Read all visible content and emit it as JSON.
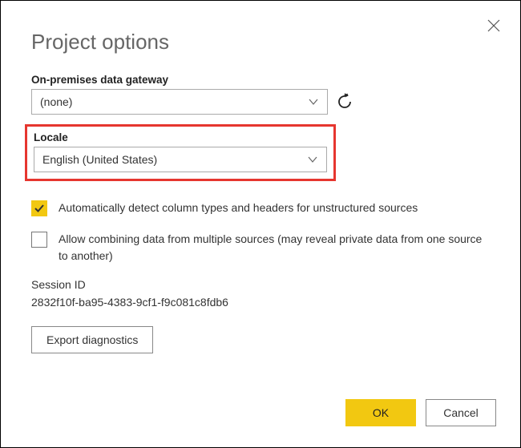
{
  "title": "Project options",
  "gateway": {
    "label": "On-premises data gateway",
    "value": "(none)"
  },
  "locale": {
    "label": "Locale",
    "value": "English (United States)"
  },
  "checkboxes": {
    "detect": "Automatically detect column types and headers for unstructured sources",
    "combine": "Allow combining data from multiple sources (may reveal private data from one source to another)"
  },
  "session": {
    "label": "Session ID",
    "value": "2832f10f-ba95-4383-9cf1-f9c081c8fdb6"
  },
  "buttons": {
    "export": "Export diagnostics",
    "ok": "OK",
    "cancel": "Cancel"
  }
}
